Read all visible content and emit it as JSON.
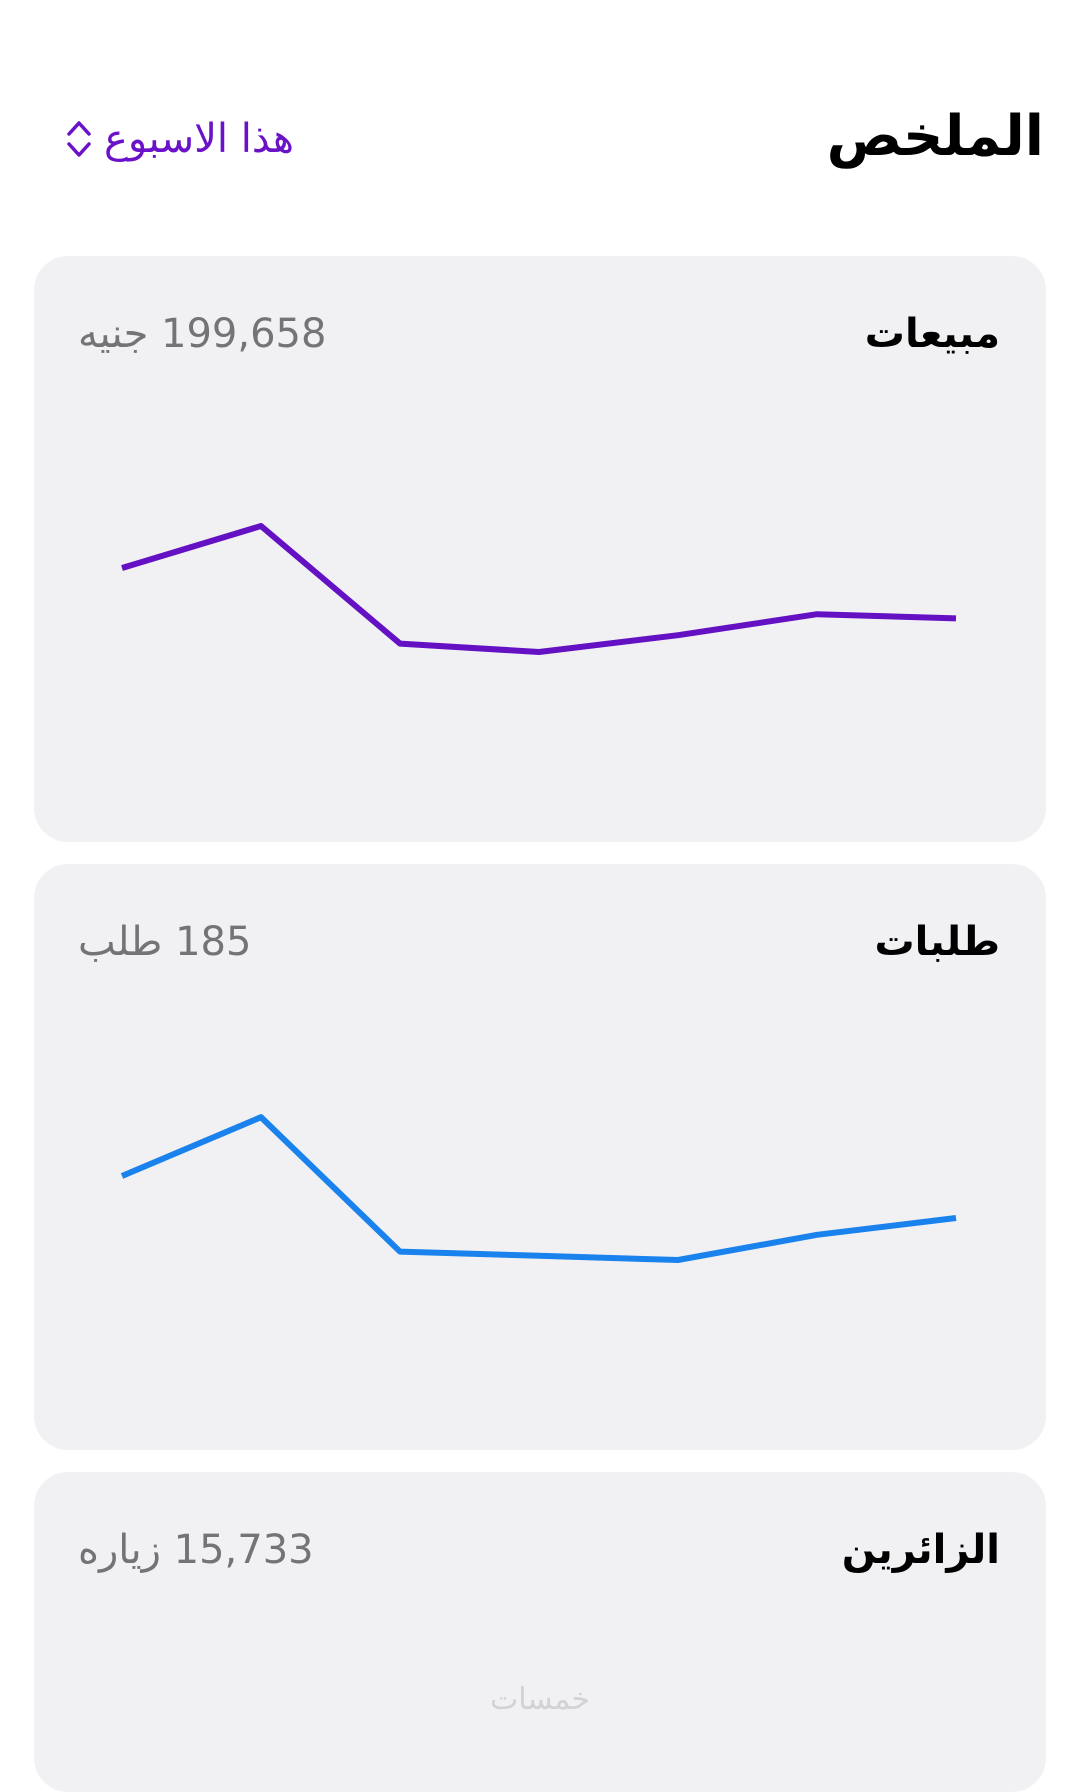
{
  "header": {
    "title": "الملخص",
    "period_label": "هذا الاسبوع",
    "accent_color": "#6a12c8",
    "period_icon": "chevron-up-down-icon"
  },
  "cards": [
    {
      "title": "مبيعات",
      "value": "199,658 جنيه",
      "line_color": "#6411c4",
      "chart_data": {
        "type": "line",
        "values": [
          4.0,
          5.0,
          2.2,
          2.0,
          2.4,
          2.9,
          2.8
        ]
      }
    },
    {
      "title": "طلبات",
      "value": "185 طلب",
      "line_color": "#1a82ec",
      "chart_data": {
        "type": "line",
        "values": [
          4.0,
          5.4,
          2.2,
          2.1,
          2.0,
          2.6,
          3.0
        ]
      }
    },
    {
      "title": "الزائرين",
      "value": "15,733 زياره"
    }
  ],
  "watermark": "خمسات"
}
